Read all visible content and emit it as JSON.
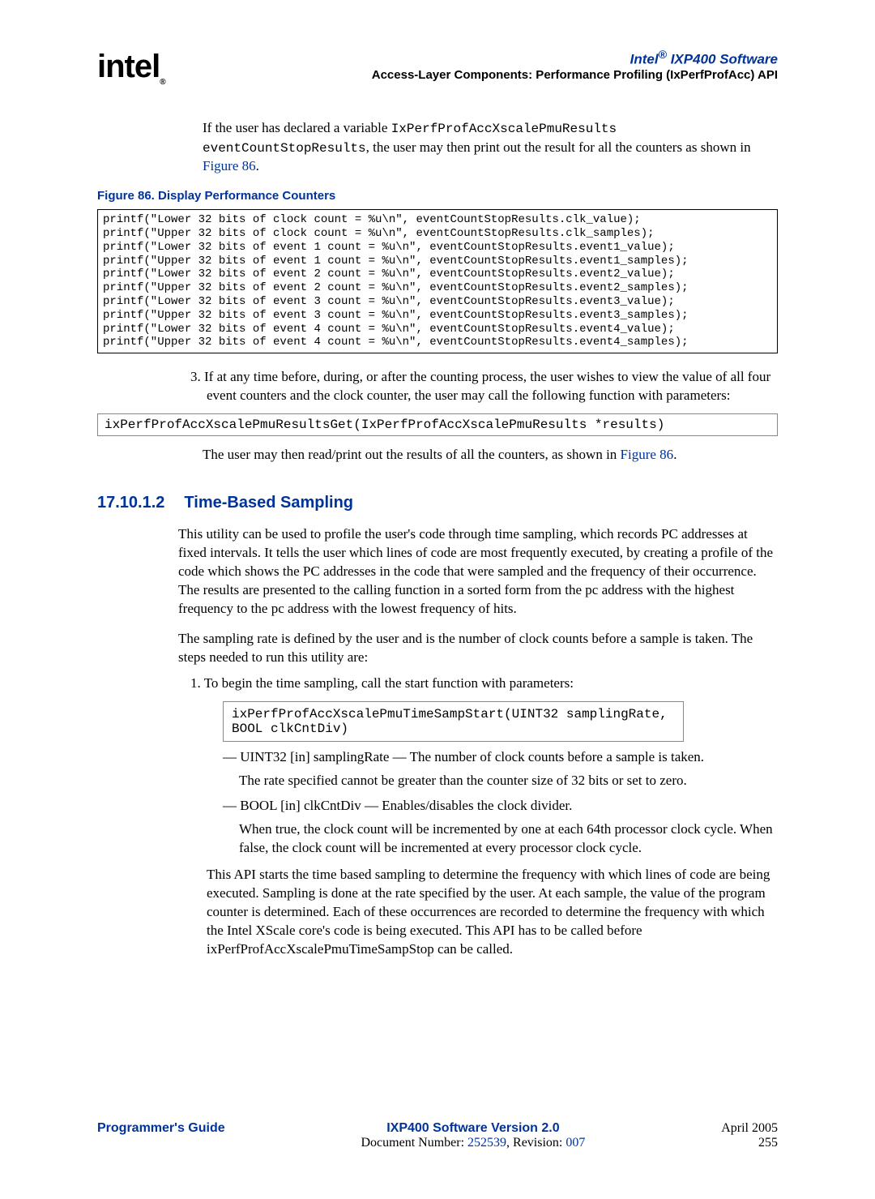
{
  "header": {
    "logo": "intel",
    "logo_reg": "®",
    "title_prefix": "Intel",
    "title_reg": "®",
    "title_suffix": " IXP400 Software",
    "subtitle": "Access-Layer Components: Performance Profiling (IxPerfProfAcc) API"
  },
  "intro": {
    "p1a": "If the user has declared a variable ",
    "p1b": "IxPerfProfAccXscalePmuResults eventCountStopResults",
    "p1c": ", the user may then print out the result for all the counters as shown in ",
    "p1link": "Figure 86",
    "p1d": "."
  },
  "figure_caption": "Figure 86. Display Performance Counters",
  "code_block": "printf(\"Lower 32 bits of clock count = %u\\n\", eventCountStopResults.clk_value);\nprintf(\"Upper 32 bits of clock count = %u\\n\", eventCountStopResults.clk_samples);\nprintf(\"Lower 32 bits of event 1 count = %u\\n\", eventCountStopResults.event1_value);\nprintf(\"Upper 32 bits of event 1 count = %u\\n\", eventCountStopResults.event1_samples);\nprintf(\"Lower 32 bits of event 2 count = %u\\n\", eventCountStopResults.event2_value);\nprintf(\"Upper 32 bits of event 2 count = %u\\n\", eventCountStopResults.event2_samples);\nprintf(\"Lower 32 bits of event 3 count = %u\\n\", eventCountStopResults.event3_value);\nprintf(\"Upper 32 bits of event 3 count = %u\\n\", eventCountStopResults.event3_samples);\nprintf(\"Lower 32 bits of event 4 count = %u\\n\", eventCountStopResults.event4_value);\nprintf(\"Upper 32 bits of event 4 count = %u\\n\", eventCountStopResults.event4_samples);",
  "item3": {
    "num": "3.  ",
    "text": "If at any time before, during, or after the counting process, the user wishes to view the value of all four event counters and the clock counter, the user may call the following function with parameters:"
  },
  "inline_code1": "ixPerfProfAccXscalePmuResultsGet(IxPerfProfAccXscalePmuResults *results)",
  "after_code1_a": "The user may then read/print out the results of all the counters, as shown in ",
  "after_code1_link": "Figure 86",
  "after_code1_b": ".",
  "section": {
    "num": "17.10.1.2",
    "title": "Time-Based Sampling"
  },
  "tbs_p1": "This utility can be used to profile the user's code through time sampling, which records PC addresses at fixed intervals.  It tells the user which lines of code are most frequently executed, by creating a profile of the code which shows the PC addresses in the code that were sampled and the frequency of their occurrence. The results are presented to the calling function in a sorted form from the pc address with the highest frequency to the pc address with the lowest frequency of hits.",
  "tbs_p2": "The sampling rate is defined by the user and is the number of clock counts before a sample is taken. The steps needed to run this utility are:",
  "step1": {
    "num": "1.  ",
    "text": "To begin the time sampling, call the start function with parameters:"
  },
  "inline_code2": "ixPerfProfAccXscalePmuTimeSampStart(UINT32 samplingRate, \nBOOL clkCntDiv)",
  "bullet1_a": "— UINT32 [in] samplingRate — The number of clock counts before a sample is taken.",
  "bullet1_b": "The rate specified cannot be greater than the counter size of 32 bits or set to zero.",
  "bullet2_a": "— BOOL [in] clkCntDiv — Enables/disables the clock divider.",
  "bullet2_b": "When true, the clock count will be incremented by one at each 64th processor clock cycle. When false, the clock count will be incremented at every processor clock cycle.",
  "tbs_p3": "This API starts the time based sampling to determine the frequency with which lines of code are being executed. Sampling is done at the rate specified by the user. At each sample, the value of the program counter is determined. Each of these occurrences are recorded to determine the frequency with which the Intel XScale core's code is being executed. This API has to be called before ixPerfProfAccXscalePmuTimeSampStop can be called.",
  "footer": {
    "left": "Programmer's Guide",
    "center_title": "IXP400 Software Version 2.0",
    "center_doc_a": "Document Number: ",
    "center_docnum": "252539",
    "center_doc_b": ", Revision: ",
    "center_rev": "007",
    "right_date": "April 2005",
    "right_page": "255"
  }
}
